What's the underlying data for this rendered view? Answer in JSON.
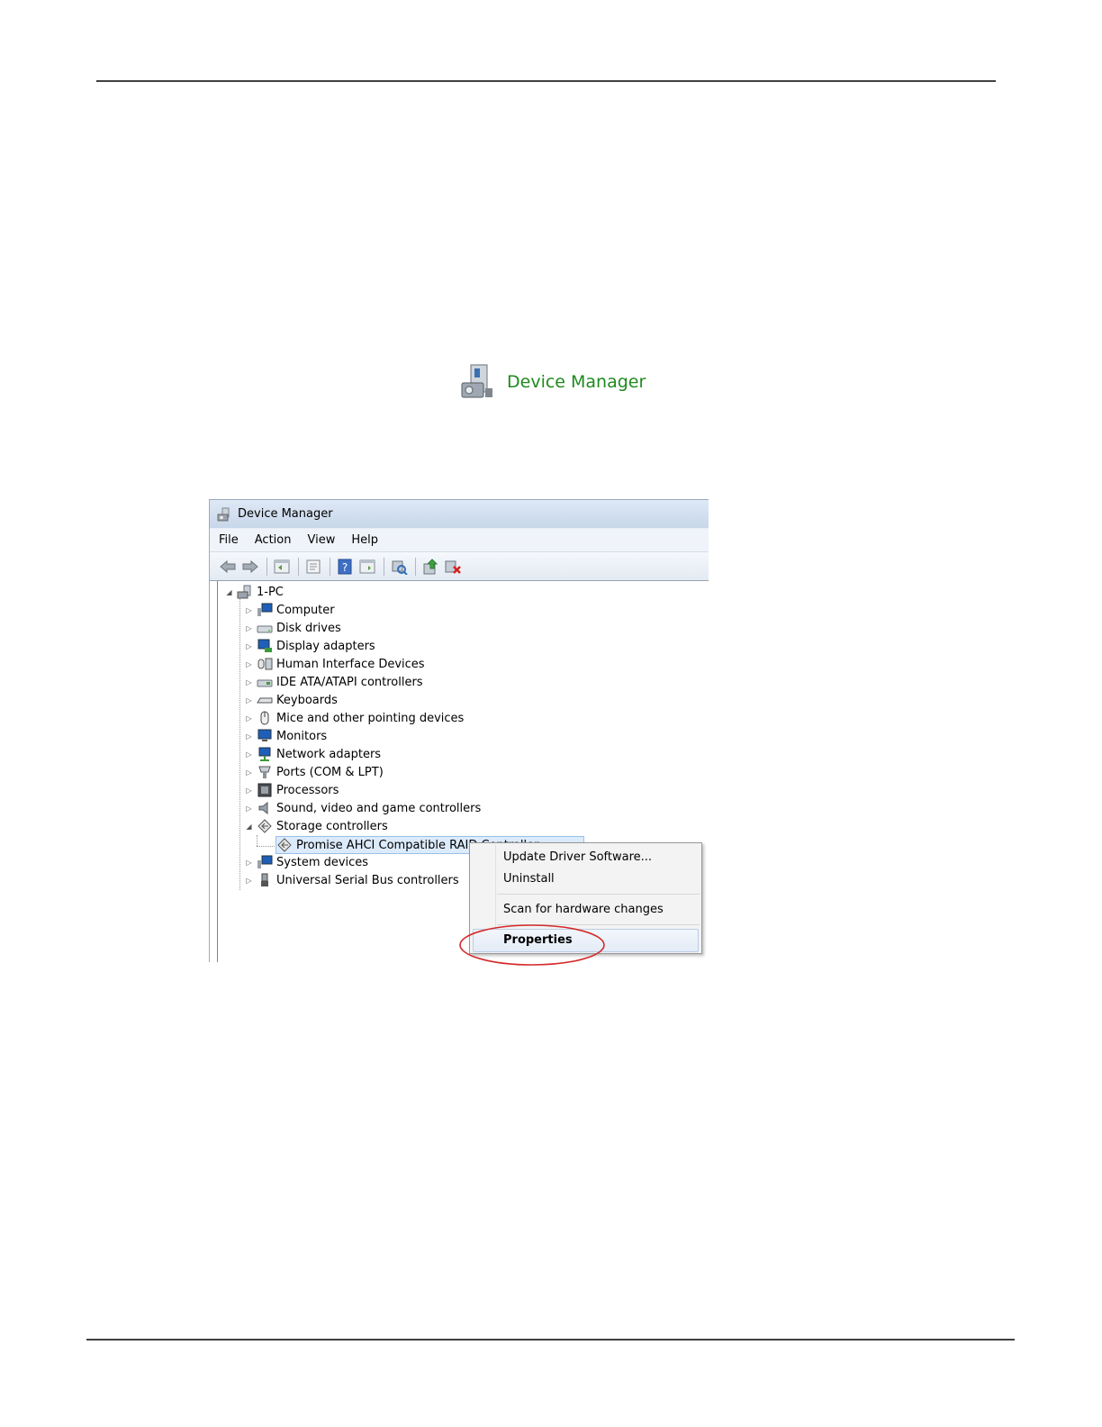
{
  "control_panel_link": {
    "label": "Device Manager",
    "icon": "device-manager-icon"
  },
  "window": {
    "title": "Device Manager",
    "menu": [
      "File",
      "Action",
      "View",
      "Help"
    ],
    "toolbar_icons": [
      "back-arrow-icon",
      "forward-arrow-icon",
      "show-hide-tree-icon",
      "properties-icon",
      "help-icon",
      "view-icon",
      "scan-hardware-icon",
      "update-driver-icon",
      "uninstall-icon"
    ],
    "tree": {
      "root": "1-PC",
      "categories": [
        {
          "label": "Computer",
          "icon": "computer-icon"
        },
        {
          "label": "Disk drives",
          "icon": "disk-drive-icon"
        },
        {
          "label": "Display adapters",
          "icon": "display-adapter-icon"
        },
        {
          "label": "Human Interface Devices",
          "icon": "hid-icon"
        },
        {
          "label": "IDE ATA/ATAPI controllers",
          "icon": "ide-controller-icon"
        },
        {
          "label": "Keyboards",
          "icon": "keyboard-icon"
        },
        {
          "label": "Mice and other pointing devices",
          "icon": "mouse-icon"
        },
        {
          "label": "Monitors",
          "icon": "monitor-icon"
        },
        {
          "label": "Network adapters",
          "icon": "network-adapter-icon"
        },
        {
          "label": "Ports (COM & LPT)",
          "icon": "port-icon"
        },
        {
          "label": "Processors",
          "icon": "processor-icon"
        },
        {
          "label": "Sound, video and game controllers",
          "icon": "speaker-icon"
        },
        {
          "label": "Storage controllers",
          "icon": "storage-controller-icon",
          "expanded": true,
          "children": [
            {
              "label": "Promise AHCI Compatible RAID Controller",
              "icon": "storage-controller-icon",
              "selected": true
            }
          ]
        },
        {
          "label": "System devices",
          "icon": "system-devices-icon"
        },
        {
          "label": "Universal Serial Bus controllers",
          "icon": "usb-icon"
        }
      ]
    }
  },
  "context_menu": {
    "items": [
      "Update Driver Software...",
      "Uninstall",
      "Scan for hardware changes",
      "Properties"
    ],
    "highlighted": "Properties",
    "annotation_color": "#d42a2a"
  }
}
